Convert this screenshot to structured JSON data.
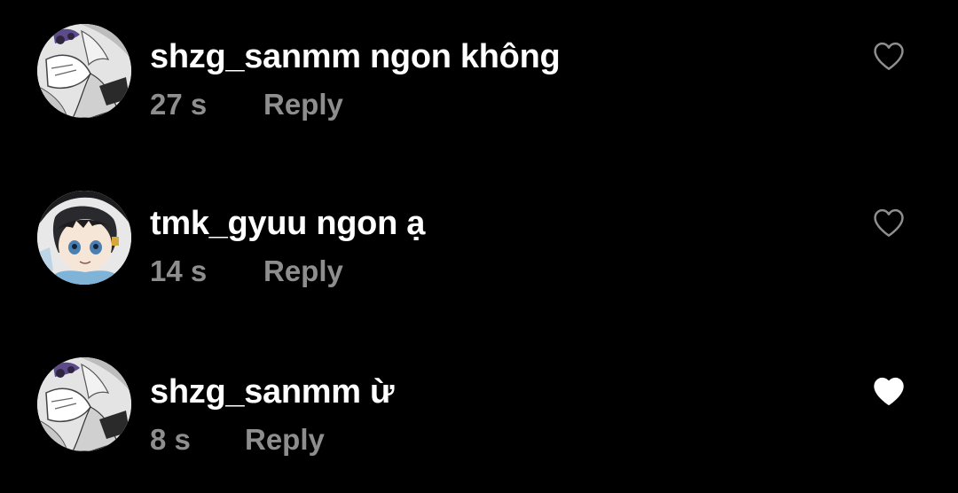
{
  "comments": [
    {
      "username": "shzg_sanmm",
      "message": "ngon không",
      "time": "27 s",
      "reply_label": "Reply",
      "liked": false,
      "avatar": "anime-character-white-hair-avatar"
    },
    {
      "username": "tmk_gyuu",
      "message": "ngon ạ",
      "time": "14 s",
      "reply_label": "Reply",
      "liked": false,
      "avatar": "anime-character-black-hair-avatar"
    },
    {
      "username": "shzg_sanmm",
      "message": "ừ",
      "time": "8 s",
      "reply_label": "Reply",
      "liked": true,
      "avatar": "anime-character-white-hair-avatar"
    }
  ],
  "colors": {
    "background": "#000000",
    "primary_text": "#ffffff",
    "secondary_text": "#8e8e8e",
    "heart_outline": "#8e8e8e",
    "heart_filled": "#ffffff"
  }
}
